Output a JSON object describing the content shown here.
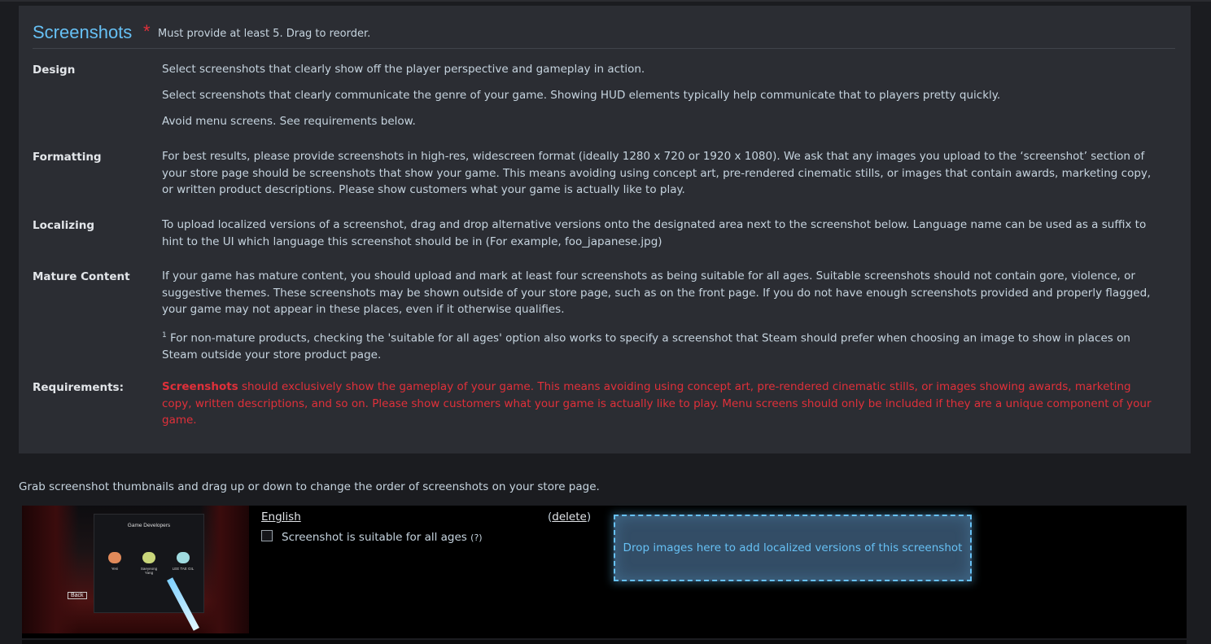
{
  "section": {
    "title": "Screenshots",
    "required_mark": "*",
    "note": "Must provide at least 5. Drag to reorder."
  },
  "rows": {
    "design": {
      "label": "Design",
      "lines": [
        "Select screenshots that clearly show off the player perspective and gameplay in action.",
        "Select screenshots that clearly communicate the genre of your game. Showing HUD elements typically help communicate that to players pretty quickly.",
        "Avoid menu screens. See requirements below."
      ]
    },
    "formatting": {
      "label": "Formatting",
      "text": "For best results, please provide screenshots in high-res, widescreen format (ideally 1280 x 720 or 1920 x 1080). We ask that any images you upload to the ‘screenshot’ section of your store page should be screenshots that show your game. This means avoiding using concept art, pre-rendered cinematic stills, or images that contain awards, marketing copy, or written product descriptions. Please show customers what your game is actually like to play."
    },
    "localizing": {
      "label": "Localizing",
      "text": "To upload localized versions of a screenshot, drag and drop alternative versions onto the designated area next to the screenshot below. Language name can be used as a suffix to hint to the UI which language this screenshot should be in (For example, foo_japanese.jpg)"
    },
    "mature": {
      "label": "Mature Content",
      "text": "If your game has mature content, you should upload and mark at least four screenshots as being suitable for all ages. Suitable screenshots should not contain gore, violence, or suggestive themes. These screenshots may be shown outside of your store page, such as on the front page. If you do not have enough screenshots provided and properly flagged, your game may not appear in these places, even if it otherwise qualifies.",
      "footnote_mark": "1",
      "footnote": " For non-mature products, checking the 'suitable for all ages' option also works to specify a screenshot that Steam should prefer when choosing an image to show in places on Steam outside your store product page."
    },
    "requirements": {
      "label": "Requirements:",
      "strong": "Screenshots",
      "text": " should exclusively show the gameplay of your game. This means avoiding using concept art, pre-rendered cinematic stills, or images showing awards, marketing copy, written descriptions, and so on. Please show customers what your game is actually like to play. Menu screens should only be included if they are a unique component of your game."
    }
  },
  "instructions": "Grab screenshot thumbnails and drag up or down to change the order of screenshots on your store page.",
  "screenshot": {
    "thumb_title": "Game Developers",
    "developers": [
      "Yeni",
      "Saeyeong Yang",
      "LEE TAE GIL"
    ],
    "thumb_back": "Back",
    "language": "English",
    "delete_open": "(",
    "delete_label": "delete",
    "delete_close": ")",
    "checkbox_label": "Screenshot is suitable for all ages",
    "help_label": "(?)",
    "checked": false,
    "dropzone_text": "Drop images here to add localized versions of this screenshot"
  },
  "colors": {
    "accent": "#66c0f4",
    "warning": "#e0303a",
    "panel": "#2b2d33"
  }
}
